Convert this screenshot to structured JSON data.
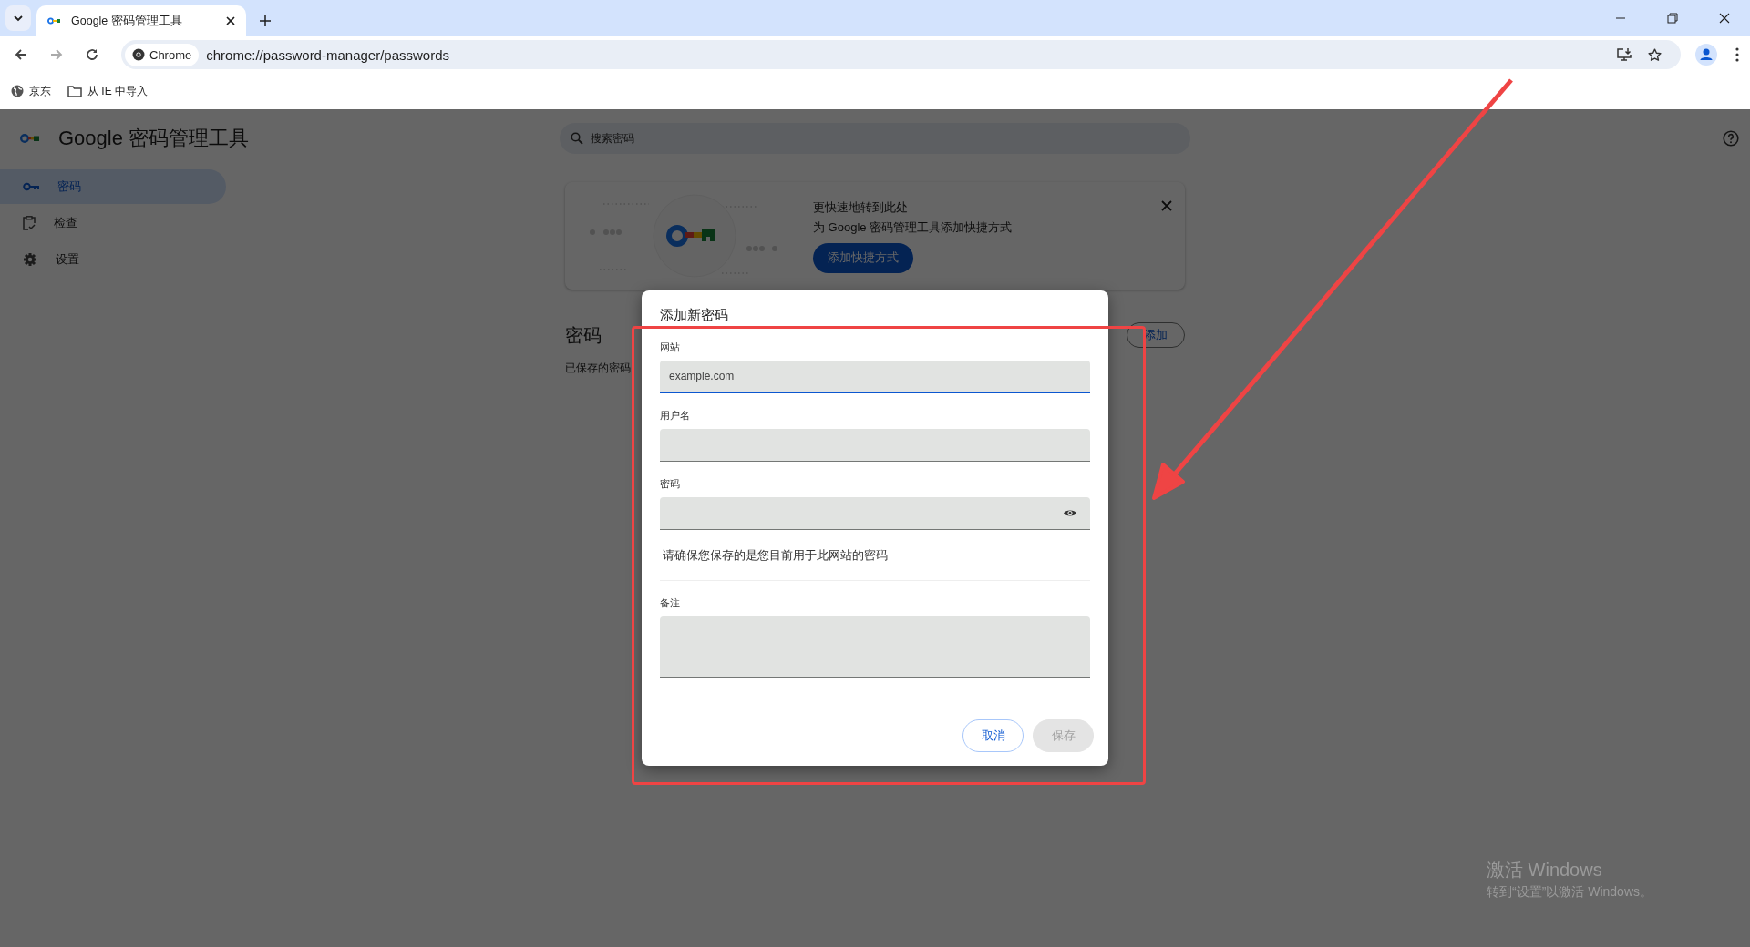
{
  "browser": {
    "tab": {
      "title": "Google 密码管理工具",
      "selected": true
    },
    "toolbar": {
      "back_disabled": false,
      "forward_disabled": true,
      "site_chip": "Chrome",
      "url": "chrome://password-manager/passwords"
    },
    "bookmarks": [
      {
        "kind": "site",
        "label": "京东"
      },
      {
        "kind": "folder",
        "label": "从 IE 中导入"
      }
    ]
  },
  "app": {
    "title": "Google 密码管理工具",
    "search": {
      "placeholder": "搜索密码"
    },
    "sidebar": {
      "items": [
        {
          "kind": "key",
          "label": "密码",
          "selected": true
        },
        {
          "kind": "checkup",
          "label": "检查",
          "selected": false
        },
        {
          "kind": "settings",
          "label": "设置",
          "selected": false
        }
      ]
    },
    "banner": {
      "title": "更快速地转到此处",
      "text": "为 Google 密码管理工具添加快捷方式",
      "button": "添加快捷方式"
    },
    "section": {
      "heading": "密码",
      "subtitle": "已保存的密码",
      "add_button": "添加"
    }
  },
  "dialog": {
    "title": "添加新密码",
    "fields": [
      {
        "kind": "text",
        "label": "网站",
        "placeholder": "example.com",
        "focused": true
      },
      {
        "kind": "text",
        "label": "用户名",
        "focused": false
      },
      {
        "kind": "password",
        "label": "密码",
        "focused": false
      }
    ],
    "hint": "请确保您保存的是您目前用于此网站的密码",
    "note": {
      "label": "备注"
    },
    "buttons": [
      {
        "label": "取消",
        "disabled": false
      },
      {
        "label": "保存",
        "disabled": true
      }
    ]
  },
  "watermark": {
    "title": "激活 Windows",
    "text": "转到“设置”以激活 Windows。"
  }
}
